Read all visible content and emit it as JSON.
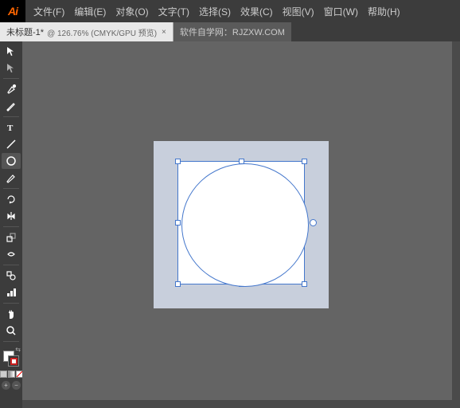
{
  "app": {
    "logo": "Ai",
    "logo_color": "#ff6600"
  },
  "menu": {
    "items": [
      "文件(F)",
      "编辑(E)",
      "对象(O)",
      "文字(T)",
      "选择(S)",
      "效果(C)",
      "视图(V)",
      "窗口(W)",
      "帮助(H)"
    ]
  },
  "tabs": {
    "active": {
      "label": "未标题-1*",
      "info": "@ 126.76% (CMYK/GPU 预览)",
      "close": "×"
    },
    "inactive": {
      "label": "软件自学网：RJZXW.COM"
    }
  },
  "canvas": {
    "bg_color": "#646464",
    "artboard_color": "#c8cfdc"
  },
  "tools": {
    "icons": [
      "▶",
      "✦",
      "✒",
      "✏",
      "T",
      "⬜",
      "○",
      "✂",
      "⟳",
      "↔",
      "📐",
      "⬡",
      "📊",
      "🖐",
      "🔍"
    ]
  },
  "colors": {
    "fill": "white",
    "stroke": "#cc0000"
  }
}
